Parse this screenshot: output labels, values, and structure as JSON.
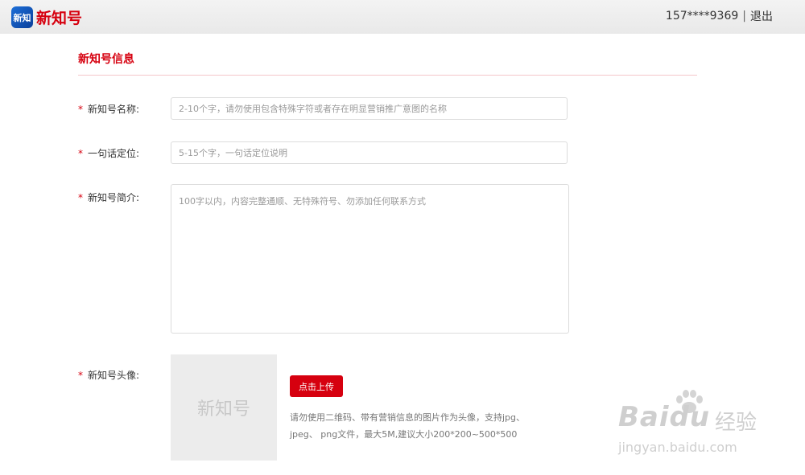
{
  "header": {
    "logo_mark": "新知",
    "logo_text": "新知号",
    "user_phone": "157****9369",
    "separator": "|",
    "logout": "退出"
  },
  "form": {
    "section_title": "新知号信息",
    "required_mark": "*",
    "name_label": "新知号名称:",
    "name_placeholder": "2-10个字，请勿使用包含特殊字符或者存在明显营销推广意图的名称",
    "slogan_label": "一句话定位:",
    "slogan_placeholder": "5-15个字，一句话定位说明",
    "intro_label": "新知号简介:",
    "intro_placeholder": "100字以内，内容完整通顺、无特殊符号、勿添加任何联系方式",
    "avatar_label": "新知号头像:",
    "avatar_placeholder_text": "新知号",
    "upload_button": "点击上传",
    "upload_hint_line1": "请勿使用二维码、带有营销信息的图片作为头像，支持jpg、",
    "upload_hint_line2": "jpeg、 png文件，最大5M,建议大小200*200~500*500"
  },
  "watermark": {
    "brand": "Baidu",
    "cn": "经验",
    "url": "jingyan.baidu.com"
  },
  "colors": {
    "accent": "#d6000f",
    "divider": "#f5c6c9",
    "logo_blue": "#1d6fd8"
  }
}
